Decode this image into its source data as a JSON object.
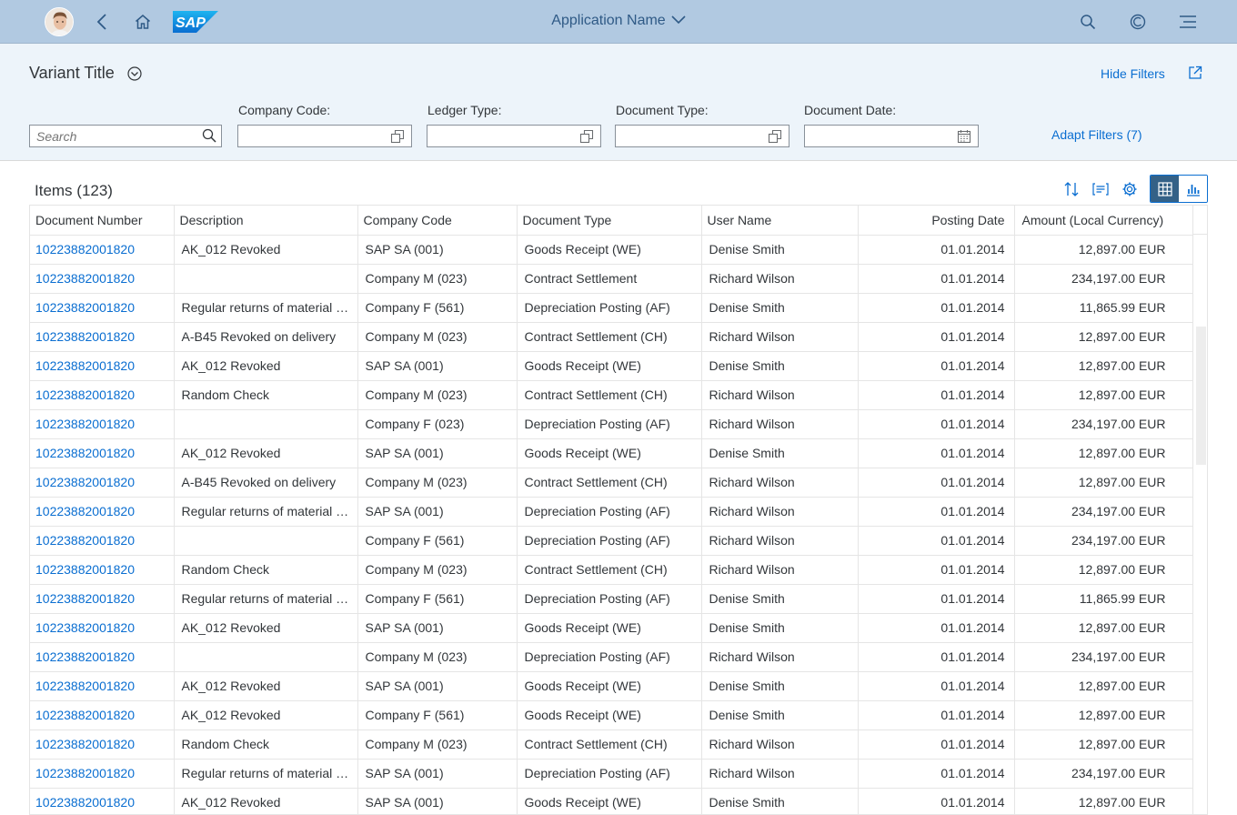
{
  "shell": {
    "app_name": "Application Name",
    "logo_text": "SAP"
  },
  "header": {
    "variant_title": "Variant Title",
    "hide_filters": "Hide Filters",
    "search_placeholder": "Search",
    "filters": [
      {
        "label": "Company Code:",
        "value": ""
      },
      {
        "label": "Ledger Type:",
        "value": ""
      },
      {
        "label": "Document Type:",
        "value": ""
      },
      {
        "label": "Document Date:",
        "value": ""
      }
    ],
    "adapt_filters": "Adapt Filters (7)"
  },
  "table": {
    "title": "Items (123)",
    "columns": [
      "Document Number",
      "Description",
      "Company Code",
      "Document Type",
      "User Name",
      "Posting Date",
      "Amount (Local Currency)"
    ],
    "rows": [
      [
        "10223882001820",
        "AK_012 Revoked",
        "SAP SA (001)",
        "Goods Receipt (WE)",
        "Denise Smith",
        "01.01.2014",
        "12,897.00 EUR"
      ],
      [
        "10223882001820",
        "",
        "Company M (023)",
        "Contract Settlement",
        "Richard Wilson",
        "01.01.2014",
        "234,197.00 EUR"
      ],
      [
        "10223882001820",
        "Regular returns of material in stock",
        "Company F (561)",
        "Depreciation Posting (AF)",
        "Denise Smith",
        "01.01.2014",
        "11,865.99 EUR"
      ],
      [
        "10223882001820",
        "A-B45 Revoked on delivery",
        "Company M (023)",
        "Contract Settlement (CH)",
        "Richard Wilson",
        "01.01.2014",
        "12,897.00 EUR"
      ],
      [
        "10223882001820",
        "AK_012 Revoked",
        "SAP SA (001)",
        "Goods Receipt (WE)",
        "Denise Smith",
        "01.01.2014",
        "12,897.00 EUR"
      ],
      [
        "10223882001820",
        "Random Check",
        "Company M (023)",
        "Contract Settlement (CH)",
        "Richard Wilson",
        "01.01.2014",
        "12,897.00 EUR"
      ],
      [
        "10223882001820",
        "",
        "Company F (023)",
        "Depreciation Posting (AF)",
        "Richard Wilson",
        "01.01.2014",
        "234,197.00 EUR"
      ],
      [
        "10223882001820",
        "AK_012 Revoked",
        "SAP SA (001)",
        "Goods Receipt (WE)",
        "Denise Smith",
        "01.01.2014",
        "12,897.00 EUR"
      ],
      [
        "10223882001820",
        "A-B45 Revoked on delivery",
        "Company M (023)",
        "Contract Settlement (CH)",
        "Richard Wilson",
        "01.01.2014",
        "12,897.00 EUR"
      ],
      [
        "10223882001820",
        "Regular returns of material in stock",
        "SAP SA (001)",
        "Depreciation Posting (AF)",
        "Richard Wilson",
        "01.01.2014",
        "234,197.00 EUR"
      ],
      [
        "10223882001820",
        "",
        "Company F (561)",
        "Depreciation Posting (AF)",
        "Richard Wilson",
        "01.01.2014",
        "234,197.00 EUR"
      ],
      [
        "10223882001820",
        "Random Check",
        "Company M (023)",
        "Contract Settlement (CH)",
        "Richard Wilson",
        "01.01.2014",
        "12,897.00 EUR"
      ],
      [
        "10223882001820",
        "Regular returns of material in stock",
        "Company F (561)",
        "Depreciation Posting (AF)",
        "Denise Smith",
        "01.01.2014",
        "11,865.99 EUR"
      ],
      [
        "10223882001820",
        "AK_012 Revoked",
        "SAP SA (001)",
        "Goods Receipt (WE)",
        "Denise Smith",
        "01.01.2014",
        "12,897.00 EUR"
      ],
      [
        "10223882001820",
        "",
        "Company M (023)",
        "Depreciation Posting (AF)",
        "Richard Wilson",
        "01.01.2014",
        "234,197.00 EUR"
      ],
      [
        "10223882001820",
        "AK_012 Revoked",
        "SAP SA (001)",
        "Goods Receipt (WE)",
        "Denise Smith",
        "01.01.2014",
        "12,897.00 EUR"
      ],
      [
        "10223882001820",
        "AK_012 Revoked",
        "Company F (561)",
        "Goods Receipt (WE)",
        "Denise Smith",
        "01.01.2014",
        "12,897.00 EUR"
      ],
      [
        "10223882001820",
        "Random Check",
        "Company M (023)",
        "Contract Settlement (CH)",
        "Richard Wilson",
        "01.01.2014",
        "12,897.00 EUR"
      ],
      [
        "10223882001820",
        "Regular returns of material in stock",
        "SAP SA (001)",
        "Depreciation Posting (AF)",
        "Richard Wilson",
        "01.01.2014",
        "234,197.00 EUR"
      ],
      [
        "10223882001820",
        "AK_012 Revoked",
        "SAP SA (001)",
        "Goods Receipt (WE)",
        "Denise Smith",
        "01.01.2014",
        "12,897.00 EUR"
      ]
    ]
  },
  "colors": {
    "shell_bg": "#b1c9e1",
    "header_bg": "#edf4fa",
    "link": "#0a6ed1",
    "active_toggle": "#346187"
  },
  "icons": [
    "avatar",
    "back-icon",
    "home-icon",
    "sap-logo",
    "chevron-down-icon",
    "search-icon",
    "notifications-icon",
    "menu-icon",
    "variant-chevron-icon",
    "share-icon",
    "value-help-icon",
    "calendar-icon",
    "sort-icon",
    "group-icon",
    "settings-icon",
    "table-view-icon",
    "chart-view-icon"
  ]
}
